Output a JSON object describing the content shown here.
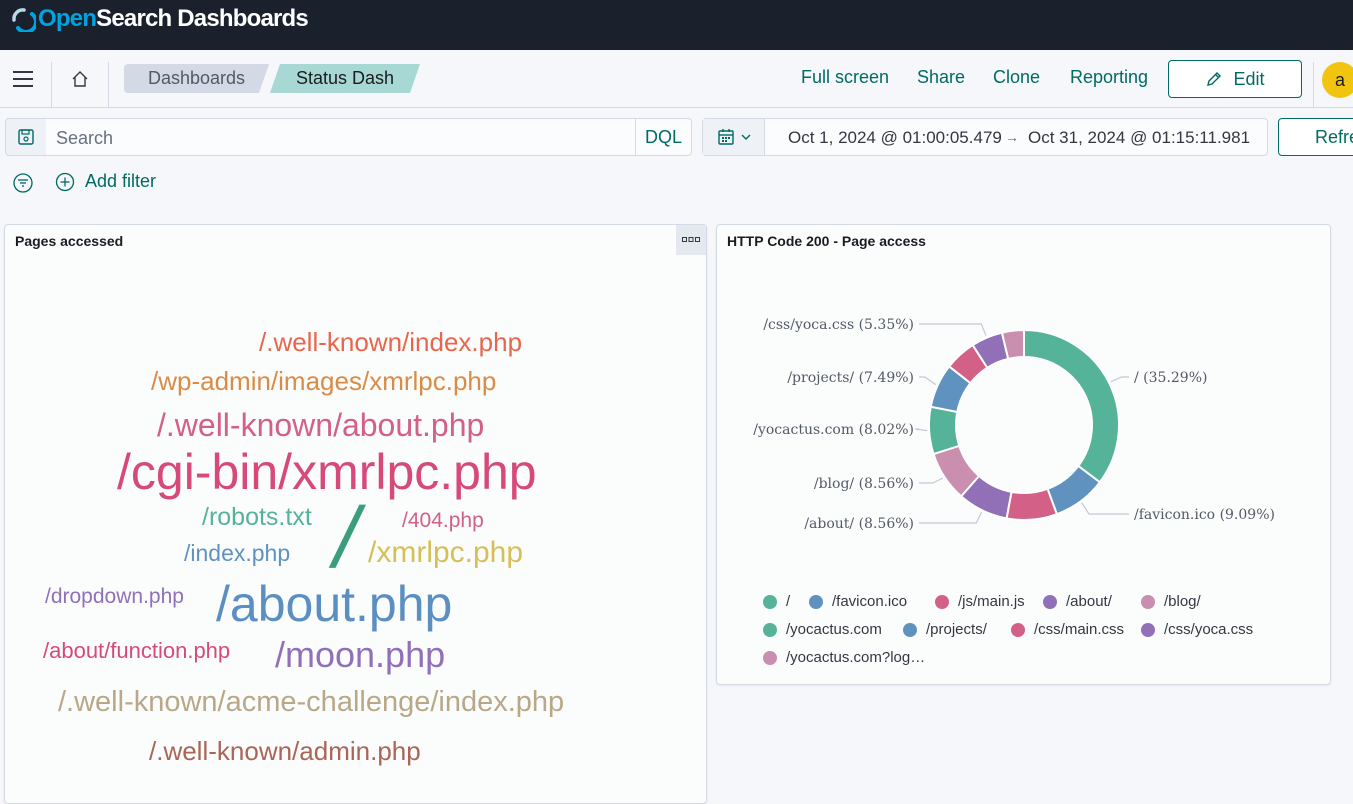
{
  "header": {
    "logo_open": "Open",
    "logo_rest": "Search Dashboards"
  },
  "nav": {
    "breadcrumbs": [
      "Dashboards",
      "Status Dash"
    ],
    "actions": [
      "Full screen",
      "Share",
      "Clone",
      "Reporting"
    ],
    "edit_label": "Edit",
    "avatar_letter": "a"
  },
  "query": {
    "search_placeholder": "Search",
    "language": "DQL",
    "date_start": "Oct 1, 2024 @ 01:00:05.479",
    "date_arrow": "→",
    "date_end": "Oct 31, 2024 @ 01:15:11.981",
    "refresh_label": "Refresh"
  },
  "filters": {
    "add_filter_label": "Add filter"
  },
  "panels": {
    "wordcloud_title": "Pages accessed",
    "donut_title": "HTTP Code 200 - Page access"
  },
  "wordcloud": {
    "words": [
      {
        "text": "/.well-known/index.php",
        "color": "#e7664c"
      },
      {
        "text": "/wp-admin/images/xmrlpc.php",
        "color": "#da8b45"
      },
      {
        "text": "/.well-known/about.php",
        "color": "#d36086"
      },
      {
        "text": "/cgi-bin/xmrlpc.php",
        "color": "#d6497a"
      },
      {
        "text": "/robots.txt",
        "color": "#54b399"
      },
      {
        "text": "/404.php",
        "color": "#d36086"
      },
      {
        "text": "/",
        "color": "#3a9e7e"
      },
      {
        "text": "/index.php",
        "color": "#6092c0"
      },
      {
        "text": "/xmrlpc.php",
        "color": "#d6bf57"
      },
      {
        "text": "/dropdown.php",
        "color": "#9170b8"
      },
      {
        "text": "/about.php",
        "color": "#5b8fc1"
      },
      {
        "text": "/about/function.php",
        "color": "#d6497a"
      },
      {
        "text": "/moon.php",
        "color": "#9170b8"
      },
      {
        "text": "/.well-known/acme-challenge/index.php",
        "color": "#b9a888"
      },
      {
        "text": "/.well-known/admin.php",
        "color": "#aa6556"
      }
    ]
  },
  "chart_data": {
    "type": "pie",
    "title": "HTTP Code 200 - Page access",
    "slices": [
      {
        "label": "/",
        "value": 35.29,
        "color": "#54b399"
      },
      {
        "label": "/favicon.ico",
        "value": 9.09,
        "color": "#6092c0"
      },
      {
        "label": "/js/main.js",
        "value": 8.56,
        "color": "#d36086"
      },
      {
        "label": "/about/",
        "value": 8.56,
        "color": "#9170b8"
      },
      {
        "label": "/blog/",
        "value": 8.56,
        "color": "#ca8eae"
      },
      {
        "label": "/yocactus.com",
        "value": 8.02,
        "color": "#54b399"
      },
      {
        "label": "/projects/",
        "value": 7.49,
        "color": "#6092c0"
      },
      {
        "label": "/css/main.css",
        "value": 5.35,
        "color": "#d36086"
      },
      {
        "label": "/css/yoca.css",
        "value": 5.35,
        "color": "#9170b8"
      },
      {
        "label": "/yocactus.com?log…",
        "value": 3.73,
        "color": "#ca8eae"
      }
    ],
    "callouts": [
      "/ (35.29%)",
      "/favicon.ico (9.09%)",
      "/about/ (8.56%)",
      "/blog/ (8.56%)",
      "/yocactus.com (8.02%)",
      "/projects/ (7.49%)",
      "/css/yoca.css (5.35%)"
    ],
    "legend": [
      "/",
      "/favicon.ico",
      "/js/main.js",
      "/about/",
      "/blog/",
      "/yocactus.com",
      "/projects/",
      "/css/main.css",
      "/css/yoca.css",
      "/yocactus.com?log…"
    ],
    "legend_placement": "bottom"
  }
}
